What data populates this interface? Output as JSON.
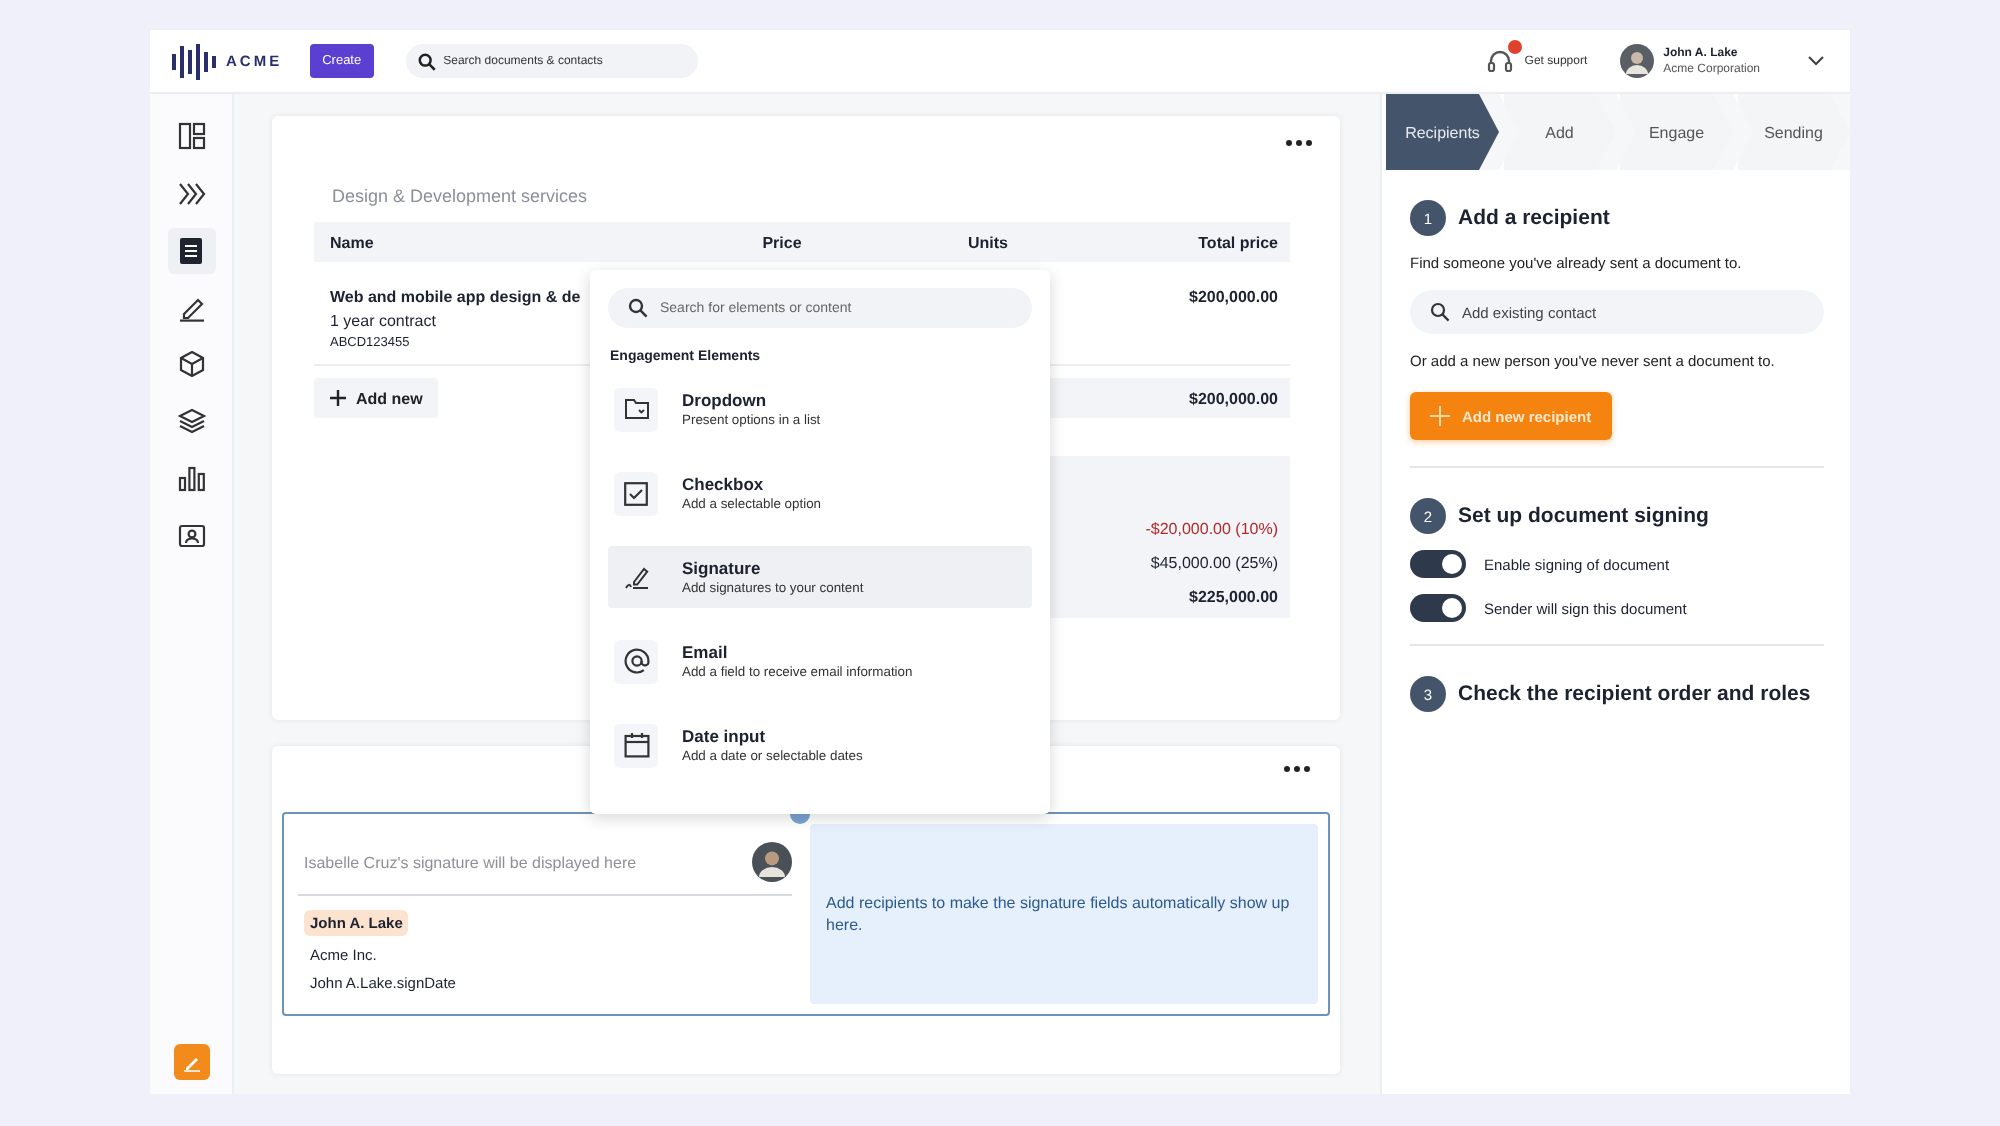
{
  "header": {
    "logo": "ACME",
    "create_button": "Create",
    "search": {
      "placeholder": "Search documents & contacts"
    },
    "support": {
      "label": "Get support",
      "notification": true
    },
    "user": {
      "name": "John A. Lake",
      "company": "Acme Corporation"
    }
  },
  "sidebar": {
    "items": [
      {
        "kind": "layout",
        "selected": false
      },
      {
        "kind": "chevrons",
        "selected": false
      },
      {
        "kind": "document",
        "selected": true
      },
      {
        "kind": "pen",
        "selected": false
      },
      {
        "kind": "cube",
        "selected": false
      },
      {
        "kind": "layers",
        "selected": false
      },
      {
        "kind": "chart",
        "selected": false
      },
      {
        "kind": "contact",
        "selected": false
      }
    ]
  },
  "pricing_card": {
    "title": "Design & Development services",
    "columns": [
      "Name",
      "Price",
      "Units",
      "Total price"
    ],
    "rows": [
      {
        "name": "Web and mobile app design & de",
        "term": "1 year contract",
        "code": "ABCD123455",
        "total": "$200,000.00"
      }
    ],
    "add_button": "Add new",
    "subtotal": "$200,000.00",
    "summary": [
      {
        "kind": "discount",
        "value": "-$20,000.00 (10%)"
      },
      {
        "kind": "tax",
        "value": "$45,000.00 (25%)"
      },
      {
        "kind": "total",
        "value": "$225,000.00"
      }
    ]
  },
  "signature_card": {
    "placeholder": "Isabelle Cruz's signature will be displayed here",
    "signer_name": "John A. Lake",
    "signer_company": "Acme Inc.",
    "sign_date": "John A.Lake.signDate",
    "hint": "Add recipients to make the signature fields automatically show up here."
  },
  "element_menu": {
    "search": {
      "placeholder": "Search for elements or content"
    },
    "heading": "Engagement Elements",
    "items": [
      {
        "kind": "dropdown",
        "title": "Dropdown",
        "description": "Present options in a list",
        "selected": false
      },
      {
        "kind": "checkbox",
        "title": "Checkbox",
        "description": "Add a selectable option",
        "selected": false
      },
      {
        "kind": "signature",
        "title": "Signature",
        "description": "Add signatures to your content",
        "selected": true
      },
      {
        "kind": "email",
        "title": "Email",
        "description": "Add a field to receive email information",
        "selected": false
      },
      {
        "kind": "date",
        "title": "Date input",
        "description": "Add a date or selectable dates",
        "selected": false
      }
    ]
  },
  "recipients_panel": {
    "steps": [
      {
        "label": "Recipients",
        "selected": true
      },
      {
        "label": "Add",
        "selected": false
      },
      {
        "label": "Engage",
        "selected": false
      },
      {
        "label": "Sending",
        "selected": false
      }
    ],
    "add_recipient": {
      "number": "1",
      "title": "Add a recipient",
      "find_text": "Find someone you've already sent a document to.",
      "search": {
        "placeholder": "Add existing contact"
      },
      "or_text": "Or add a new person you've never sent a document to.",
      "add_button": "Add new recipient"
    },
    "signing": {
      "number": "2",
      "title": "Set up document signing",
      "toggles": [
        {
          "label": "Enable signing of document",
          "on": true
        },
        {
          "label": "Sender will sign this document",
          "on": true
        }
      ]
    },
    "order": {
      "number": "3",
      "title": "Check the recipient order and roles"
    }
  }
}
